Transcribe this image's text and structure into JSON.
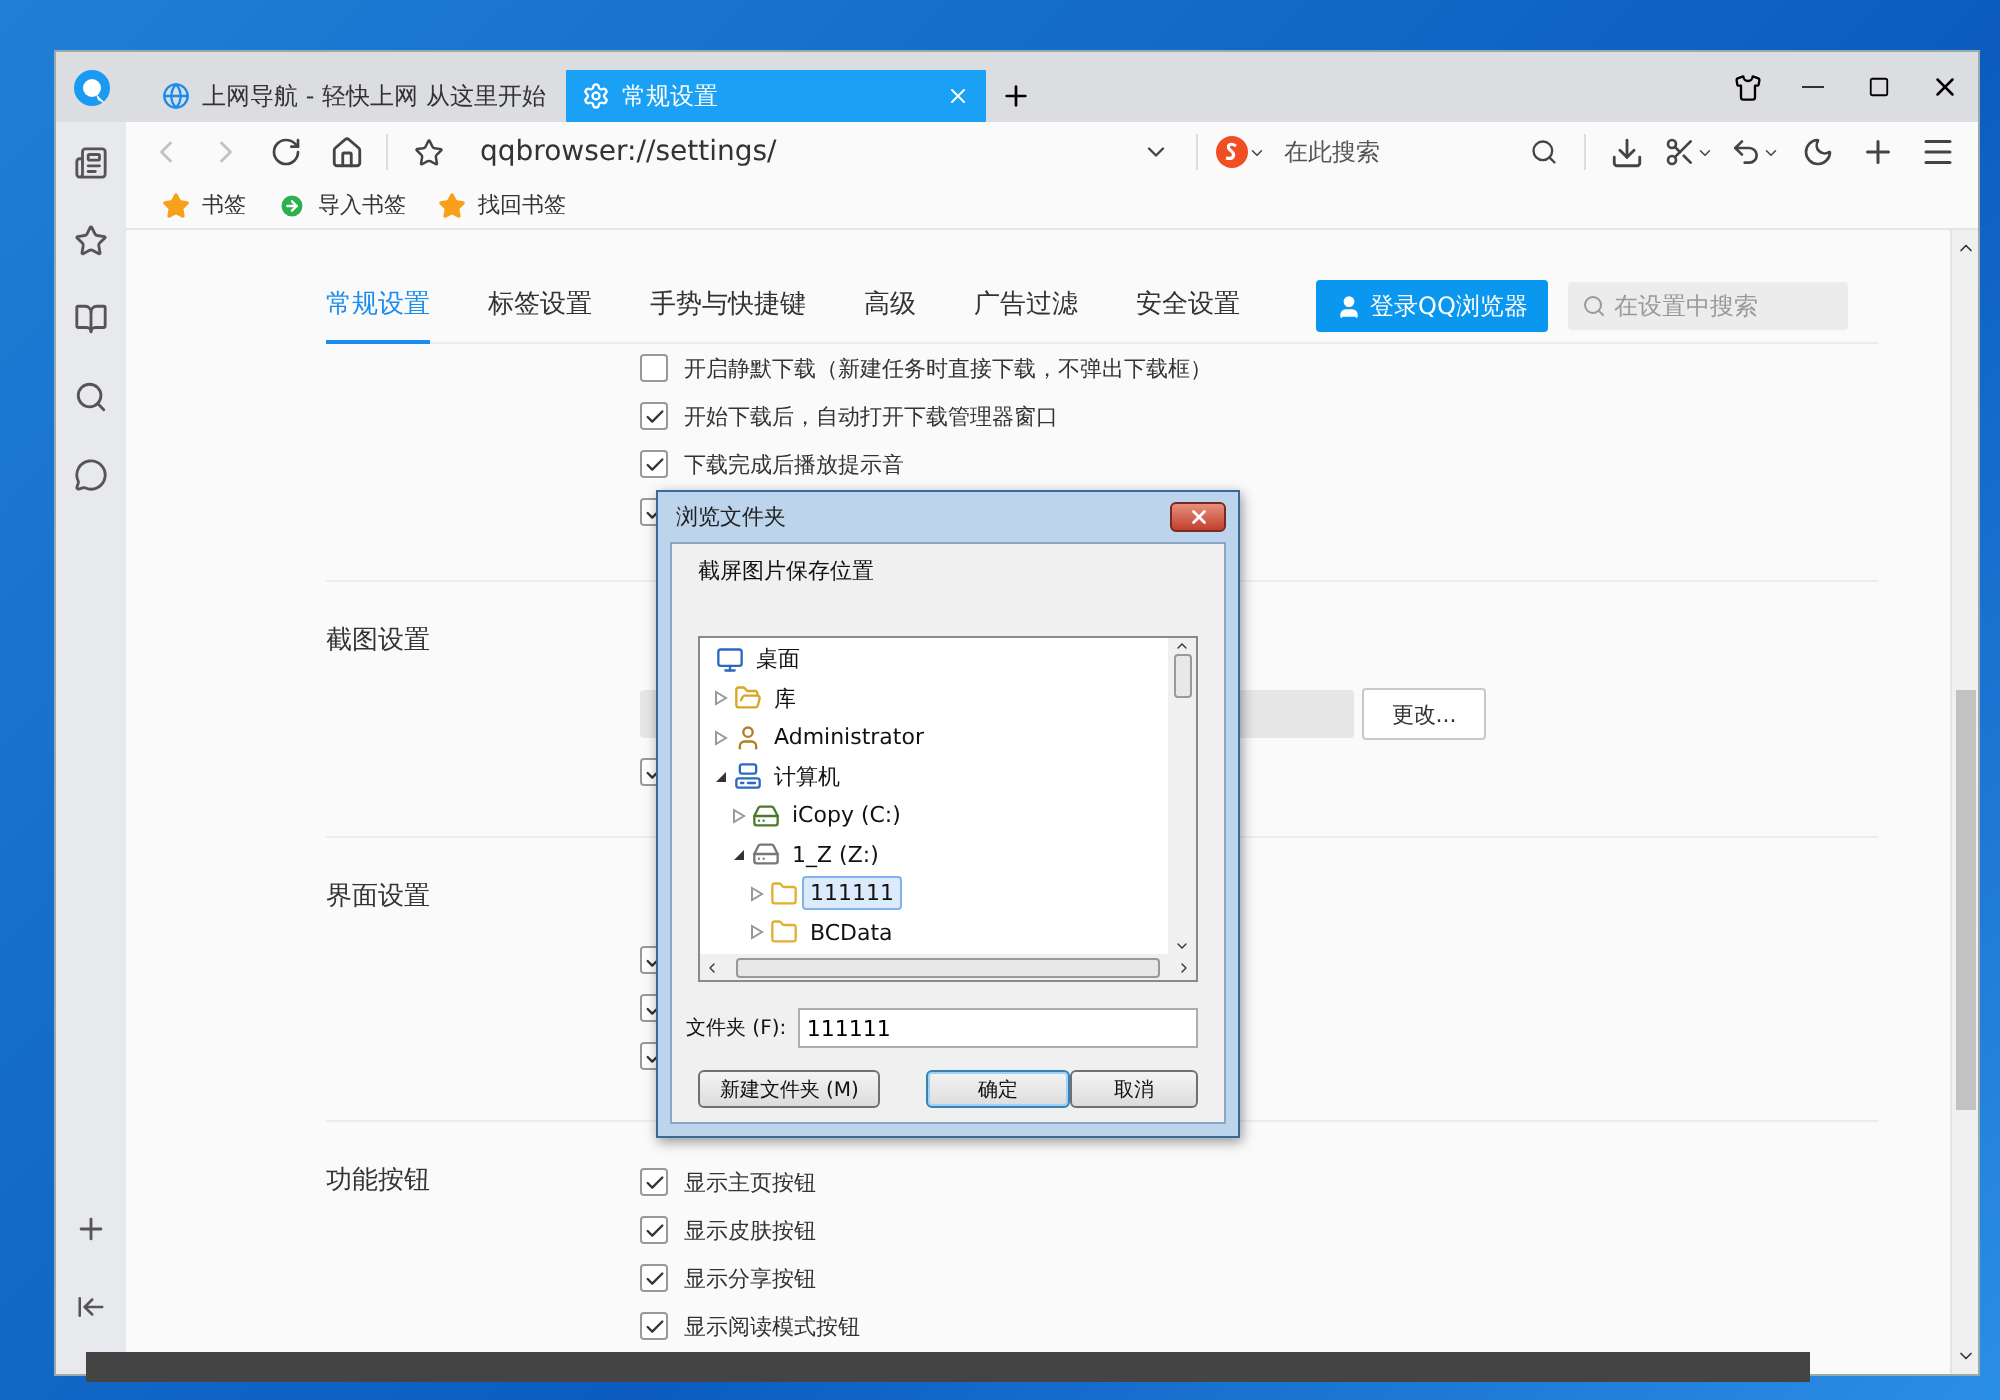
{
  "browser": {
    "tabs": [
      {
        "title": "上网导航 - 轻快上网 从这里开始",
        "selected": false
      },
      {
        "title": "常规设置",
        "selected": true
      }
    ],
    "address": "qqbrowser://settings/",
    "search_placeholder": "在此搜索",
    "bookmarks": [
      {
        "kind": "star",
        "label": "书签"
      },
      {
        "kind": "import",
        "label": "导入书签"
      },
      {
        "kind": "star",
        "label": "找回书签"
      }
    ]
  },
  "settings": {
    "nav": [
      {
        "label": "常规设置",
        "selected": true
      },
      {
        "label": "标签设置",
        "selected": false
      },
      {
        "label": "手势与快捷键",
        "selected": false
      },
      {
        "label": "高级",
        "selected": false
      },
      {
        "label": "广告过滤",
        "selected": false
      },
      {
        "label": "安全设置",
        "selected": false
      }
    ],
    "login_button": "登录QQ浏览器",
    "search_placeholder": "在设置中搜索",
    "sections": [
      {
        "rows": [
          {
            "kind": "checkbox",
            "label": "开启静默下载（新建任务时直接下载，不弹出下载框）",
            "checked": false
          },
          {
            "kind": "checkbox",
            "label": "开始下载后，自动打开下载管理器窗口",
            "checked": true
          },
          {
            "kind": "checkbox",
            "label": "下载完成后播放提示音",
            "checked": true
          },
          {
            "kind": "checkbox",
            "checked": true
          }
        ]
      },
      {
        "title": "截图设置",
        "rows": [
          {
            "kind": "covered"
          },
          {
            "kind": "path",
            "button": "更改..."
          },
          {
            "kind": "checkbox",
            "checked": true
          }
        ]
      },
      {
        "title": "界面设置",
        "rows": [
          {
            "kind": "covered"
          },
          {
            "kind": "checkbox",
            "checked": true
          },
          {
            "kind": "checkbox",
            "checked": true
          },
          {
            "kind": "checkbox",
            "checked": true
          }
        ]
      },
      {
        "title": "功能按钮",
        "rows": [
          {
            "kind": "checkbox",
            "label": "显示主页按钮",
            "checked": true
          },
          {
            "kind": "checkbox",
            "label": "显示皮肤按钮",
            "checked": true
          },
          {
            "kind": "checkbox",
            "label": "显示分享按钮",
            "checked": true
          },
          {
            "kind": "checkbox",
            "label": "显示阅读模式按钮",
            "checked": true
          }
        ]
      }
    ]
  },
  "dialog": {
    "title": "浏览文件夹",
    "prompt": "截屏图片保存位置",
    "tree": [
      {
        "label": "桌面",
        "kind": "desktop",
        "selected": false,
        "children": [
          {
            "label": "库",
            "kind": "library",
            "expanded": false,
            "selected": false
          },
          {
            "label": "Administrator",
            "kind": "user",
            "expanded": false,
            "selected": false
          },
          {
            "label": "计算机",
            "kind": "computer",
            "expanded": true,
            "selected": false,
            "children": [
              {
                "label": "iCopy (C:)",
                "kind": "system-drive",
                "expanded": false,
                "selected": false
              },
              {
                "label": "1_Z (Z:)",
                "kind": "drive",
                "expanded": true,
                "selected": false,
                "children": [
                  {
                    "label": "111111",
                    "kind": "folder",
                    "expanded": false,
                    "selected": true
                  },
                  {
                    "label": "BCData",
                    "kind": "folder",
                    "expanded": false,
                    "selected": false
                  }
                ]
              }
            ]
          }
        ]
      }
    ],
    "folder_label": "文件夹 (F):",
    "folder_value": "111111",
    "buttons": [
      {
        "label": "新建文件夹 (M)",
        "default": false
      },
      {
        "label": "确定",
        "default": true
      },
      {
        "label": "取消",
        "default": false
      }
    ]
  }
}
